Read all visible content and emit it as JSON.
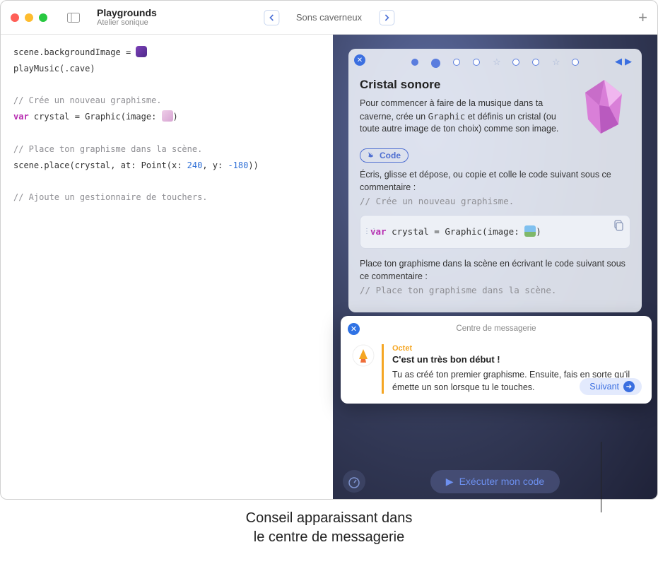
{
  "titlebar": {
    "app_title": "Playgrounds",
    "subtitle": "Atelier sonique",
    "nav_title": "Sons caverneux"
  },
  "code": {
    "line1a": "scene.backgroundImage = ",
    "line2": "playMusic(.cave)",
    "comment1": "// Crée un nouveau graphisme.",
    "line3_var": "var",
    "line3_rest": " crystal = Graphic(image: ",
    "comment2": "// Place ton graphisme dans la scène.",
    "line4_a": "scene.place(crystal, at: Point(x: ",
    "line4_n1": "240",
    "line4_b": ", y: ",
    "line4_n2": "-180",
    "line4_c": "))",
    "comment3": "// Ajoute un gestionnaire de touchers."
  },
  "lesson": {
    "title": "Cristal sonore",
    "intro_a": "Pour commencer à faire de la musique dans ta caverne, crée un ",
    "intro_mono": "Graphic",
    "intro_b": " et définis un cristal (ou toute autre image de ton choix) comme son image.",
    "code_badge": "Code",
    "step1": "Écris, glisse et dépose, ou copie et colle le code suivant sous ce commentaire :",
    "step1_comment": "// Crée un nouveau graphisme.",
    "snippet_kw": "var",
    "snippet_rest": " crystal = Graphic(image: ",
    "step2": "Place ton graphisme dans la scène en écrivant le code suivant sous ce commentaire :",
    "step2_comment": "// Place ton graphisme dans la scène."
  },
  "run_button": "Exécuter mon code",
  "popup": {
    "header": "Centre de messagerie",
    "sender": "Octet",
    "title": "C'est un très bon début !",
    "body": "Tu as créé ton premier graphisme. Ensuite, fais en sorte qu'il émette un son lorsque tu le touches.",
    "next": "Suivant"
  },
  "caption_line1": "Conseil apparaissant dans",
  "caption_line2": "le centre de messagerie"
}
